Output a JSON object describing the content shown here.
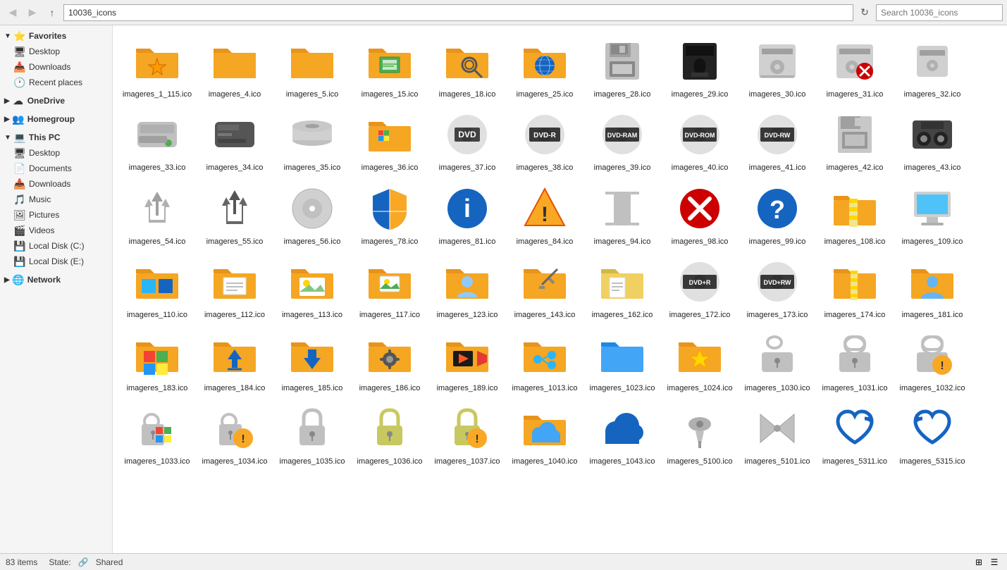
{
  "topbar": {
    "back_btn": "◀",
    "forward_btn": "▶",
    "up_btn": "↑",
    "address": "10036_icons",
    "search_placeholder": "Search 10036_icons",
    "refresh_btn": "↻"
  },
  "sidebar": {
    "favorites_label": "Favorites",
    "favorites_items": [
      {
        "label": "Desktop",
        "icon": "🖥"
      },
      {
        "label": "Downloads",
        "icon": "📥"
      },
      {
        "label": "Recent places",
        "icon": "🕐"
      }
    ],
    "onedrive_label": "OneDrive",
    "homegroup_label": "Homegroup",
    "thispc_label": "This PC",
    "thispc_items": [
      {
        "label": "Desktop",
        "icon": "🖥"
      },
      {
        "label": "Documents",
        "icon": "📄"
      },
      {
        "label": "Downloads",
        "icon": "📥"
      },
      {
        "label": "Music",
        "icon": "🎵"
      },
      {
        "label": "Pictures",
        "icon": "🖼"
      },
      {
        "label": "Videos",
        "icon": "🎬"
      },
      {
        "label": "Local Disk (C:)",
        "icon": "💾"
      },
      {
        "label": "Local Disk (E:)",
        "icon": "💾"
      }
    ],
    "network_label": "Network"
  },
  "icons": [
    {
      "label": "imageres_1_115.ico",
      "type": "folder-star"
    },
    {
      "label": "imageres_4.ico",
      "type": "folder"
    },
    {
      "label": "imageres_5.ico",
      "type": "folder"
    },
    {
      "label": "imageres_15.ico",
      "type": "folder-green"
    },
    {
      "label": "imageres_18.ico",
      "type": "folder-search"
    },
    {
      "label": "imageres_25.ico",
      "type": "folder-blue-globe"
    },
    {
      "label": "imageres_28.ico",
      "type": "floppy35"
    },
    {
      "label": "imageres_29.ico",
      "type": "floppy525"
    },
    {
      "label": "imageres_30.ico",
      "type": "disk-grey"
    },
    {
      "label": "imageres_31.ico",
      "type": "disk-red-x"
    },
    {
      "label": "imageres_32.ico",
      "type": "disk-small"
    },
    {
      "label": "imageres_33.ico",
      "type": "hdd-green"
    },
    {
      "label": "imageres_34.ico",
      "type": "hdd-dark"
    },
    {
      "label": "imageres_35.ico",
      "type": "disk-flat"
    },
    {
      "label": "imageres_36.ico",
      "type": "win-logo-folder"
    },
    {
      "label": "imageres_37.ico",
      "type": "dvd-label"
    },
    {
      "label": "imageres_38.ico",
      "type": "dvd-r"
    },
    {
      "label": "imageres_39.ico",
      "type": "dvd-ram"
    },
    {
      "label": "imageres_40.ico",
      "type": "dvd-rom"
    },
    {
      "label": "imageres_41.ico",
      "type": "dvd-rw"
    },
    {
      "label": "imageres_42.ico",
      "type": "floppy-old"
    },
    {
      "label": "imageres_43.ico",
      "type": "tape"
    },
    {
      "label": "imageres_54.ico",
      "type": "recycle-empty"
    },
    {
      "label": "imageres_55.ico",
      "type": "recycle-full"
    },
    {
      "label": "imageres_56.ico",
      "type": "cd-disc"
    },
    {
      "label": "imageres_78.ico",
      "type": "shield-blue-yellow"
    },
    {
      "label": "imageres_81.ico",
      "type": "info-circle"
    },
    {
      "label": "imageres_84.ico",
      "type": "warning-yellow"
    },
    {
      "label": "imageres_94.ico",
      "type": "text-cursor"
    },
    {
      "label": "imageres_98.ico",
      "type": "error-red-x"
    },
    {
      "label": "imageres_99.ico",
      "type": "help-circle"
    },
    {
      "label": "imageres_108.ico",
      "type": "folder-zip"
    },
    {
      "label": "imageres_109.ico",
      "type": "monitor"
    },
    {
      "label": "imageres_110.ico",
      "type": "win10-folder"
    },
    {
      "label": "imageres_112.ico",
      "type": "folder-document"
    },
    {
      "label": "imageres_113.ico",
      "type": "folder-pictures"
    },
    {
      "label": "imageres_117.ico",
      "type": "folder-photos2"
    },
    {
      "label": "imageres_123.ico",
      "type": "folder-user"
    },
    {
      "label": "imageres_143.ico",
      "type": "folder-pencil"
    },
    {
      "label": "imageres_162.ico",
      "type": "folder-document2"
    },
    {
      "label": "imageres_172.ico",
      "type": "dvdplus-r"
    },
    {
      "label": "imageres_173.ico",
      "type": "dvdplus-rw"
    },
    {
      "label": "imageres_174.ico",
      "type": "folder-zip2"
    },
    {
      "label": "imageres_181.ico",
      "type": "folder-user2"
    },
    {
      "label": "imageres_183.ico",
      "type": "folder-win"
    },
    {
      "label": "imageres_184.ico",
      "type": "folder-download"
    },
    {
      "label": "imageres_185.ico",
      "type": "folder-arrow"
    },
    {
      "label": "imageres_186.ico",
      "type": "folder-settings"
    },
    {
      "label": "imageres_189.ico",
      "type": "folder-video"
    },
    {
      "label": "imageres_1013.ico",
      "type": "folder-network"
    },
    {
      "label": "imageres_1023.ico",
      "type": "folder-blue"
    },
    {
      "label": "imageres_1024.ico",
      "type": "folder-star2"
    },
    {
      "label": "imageres_1030.ico",
      "type": "lock-open"
    },
    {
      "label": "imageres_1031.ico",
      "type": "lock-closed"
    },
    {
      "label": "imageres_1032.ico",
      "type": "lock-warning"
    },
    {
      "label": "imageres_1033.ico",
      "type": "lock-win1"
    },
    {
      "label": "imageres_1034.ico",
      "type": "lock-win2"
    },
    {
      "label": "imageres_1035.ico",
      "type": "lock-plain1"
    },
    {
      "label": "imageres_1036.ico",
      "type": "lock-plain2"
    },
    {
      "label": "imageres_1037.ico",
      "type": "lock-yellow-warning"
    },
    {
      "label": "imageres_1040.ico",
      "type": "folder-cloud"
    },
    {
      "label": "imageres_1043.ico",
      "type": "cloud-blue"
    },
    {
      "label": "imageres_5100.ico",
      "type": "pushpin"
    },
    {
      "label": "imageres_5101.ico",
      "type": "bowtie"
    },
    {
      "label": "imageres_5311.ico",
      "type": "redo-heart"
    },
    {
      "label": "imageres_5315.ico",
      "type": "undo-heart"
    }
  ],
  "statusbar": {
    "count": "83 items",
    "state_label": "State:",
    "state_value": "Shared"
  }
}
